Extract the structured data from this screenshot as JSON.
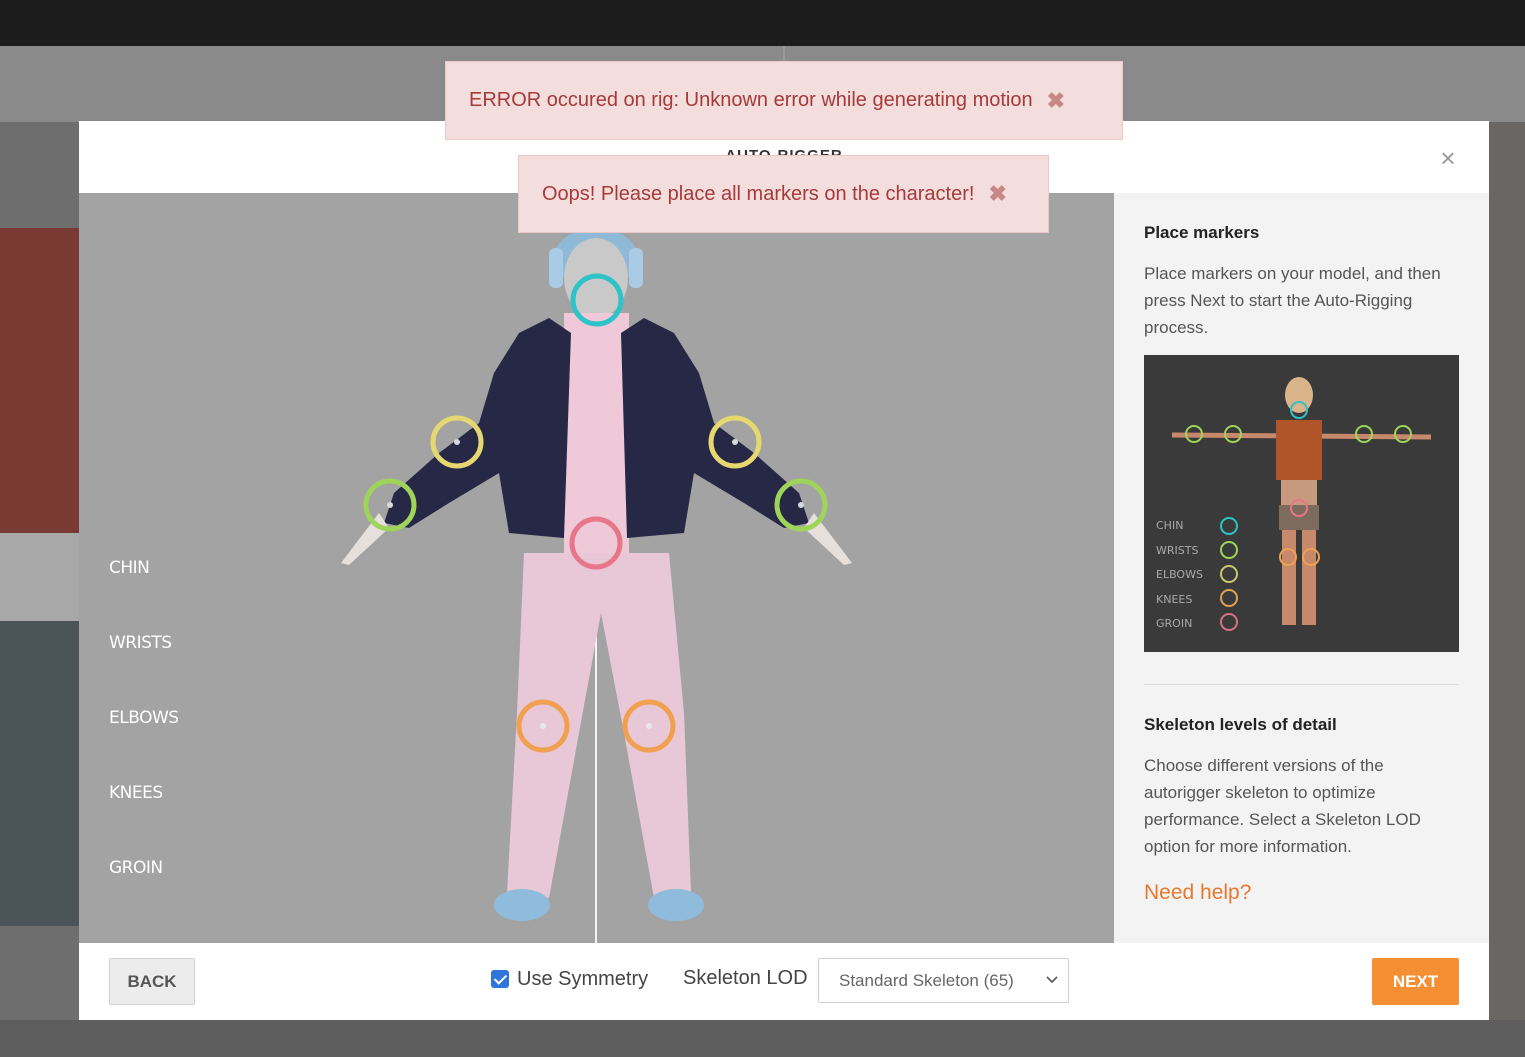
{
  "toasts": {
    "error_message": "ERROR occured on rig: Unknown error while generating motion",
    "oops_message": "Oops! Please place all markers on the character!",
    "close_glyph": "✖"
  },
  "modal": {
    "title": "AUTO-RIGGER",
    "close_glyph": "×"
  },
  "markers": {
    "labels": [
      "CHIN",
      "WRISTS",
      "ELBOWS",
      "KNEES",
      "GROIN"
    ],
    "colors": {
      "chin": "#2ec3c7",
      "wrists": "#9ed45a",
      "elbows": "#e6d870",
      "knees": "#f0a050",
      "groin": "#e8768a"
    }
  },
  "side_panel": {
    "place_title": "Place markers",
    "place_text": "Place markers on your model, and then press Next to start the Auto-Rigging process.",
    "ref_legend": [
      "CHIN",
      "WRISTS",
      "ELBOWS",
      "KNEES",
      "GROIN"
    ],
    "lod_title": "Skeleton levels of detail",
    "lod_text": "Choose different versions of the autorigger skeleton to optimize performance. Select a Skeleton LOD option for more information.",
    "help_link": "Need help?"
  },
  "footer": {
    "back_label": "BACK",
    "symmetry_label": "Use Symmetry",
    "symmetry_checked": true,
    "lod_label": "Skeleton LOD",
    "lod_selected": "Standard Skeleton (65)",
    "next_label": "NEXT"
  },
  "colors": {
    "accent_orange": "#f58f34",
    "link_orange": "#e8782e",
    "toast_bg": "#f4dddd",
    "toast_text": "#a63a3a"
  }
}
